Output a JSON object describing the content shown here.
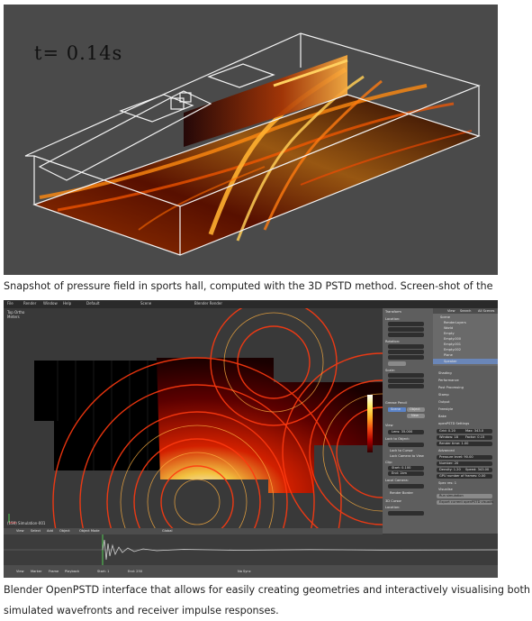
{
  "figure1": {
    "time_label": "t= 0.14s"
  },
  "caption1": "Snapshot of pressure field in sports hall, computed with the 3D PSTD method. Screen-shot of the",
  "figure2": {
    "top_menu": [
      "File",
      "Render",
      "Window",
      "Help",
      "Default",
      "Scene",
      "Blender Render"
    ],
    "view_title": "Top Ortho",
    "view_sub": "Meters",
    "object_label": "(150) Simulation-001",
    "npanel": {
      "title": "Transform",
      "location_label": "Location:",
      "rotation_label": "Rotation:",
      "scale_label": "Scale:",
      "dimensions_label": "Dimensions:",
      "grease_pencil": "Grease Pencil",
      "view": "View",
      "lens": "Lens: 35.000",
      "lock_to_object": "Lock to Object:",
      "lock_to_cursor": "Lock to Cursor",
      "lock_camera": "Lock Camera to View",
      "clip_label": "Clip:",
      "clip_start": "Start: 0.100",
      "clip_end": "End: 1km",
      "local_camera": "Local Camera:",
      "render_border": "Render Border",
      "cursor_3d": "3D Cursor",
      "cursor_location": "Location:",
      "scene_tab": "Scene",
      "object_tab": "Object",
      "new_btn": "New"
    },
    "outliner": {
      "header": [
        "View",
        "Search",
        "All Scenes"
      ],
      "items": [
        "Scene",
        "RenderLayers",
        "World",
        "Empty",
        "Empty.000",
        "Empty.001",
        "Empty.002",
        "Plane",
        "Speaker"
      ]
    },
    "props": {
      "sections": [
        "Shading",
        "Performance",
        "Post Processing",
        "Stamp",
        "Output",
        "Freestyle",
        "Bake",
        "openPSTD Settings"
      ],
      "settings": [
        "Grid: 0.20",
        "Max: 343.0",
        "Window: 18",
        "Factor: 0.15",
        "Render time: 1.00",
        "Advanced",
        "Pressure level: 90.00",
        "Number: 20",
        "Density: 1.20",
        "Speed: 343.00",
        "GPU number of frames: 0.00",
        "Spec res: 1",
        "Visualise",
        "Run simulation",
        "Export current openPSTD visualis"
      ]
    },
    "colorbar": {
      "stops": [
        "#ffffff",
        "#ffee66",
        "#ffaa22",
        "#ee4411",
        "#aa0000",
        "#300000"
      ]
    },
    "view_header": [
      "View",
      "Select",
      "Add",
      "Object",
      "Object Mode",
      "Global"
    ],
    "bottom_bar": [
      "View",
      "Marker",
      "Frame",
      "Playback",
      "Start: 1",
      "End: 250",
      "No Sync"
    ]
  },
  "caption2": "Blender OpenPSTD interface that allows for easily creating geometries and interactively visualising both simulated wavefronts and receiver impulse responses."
}
